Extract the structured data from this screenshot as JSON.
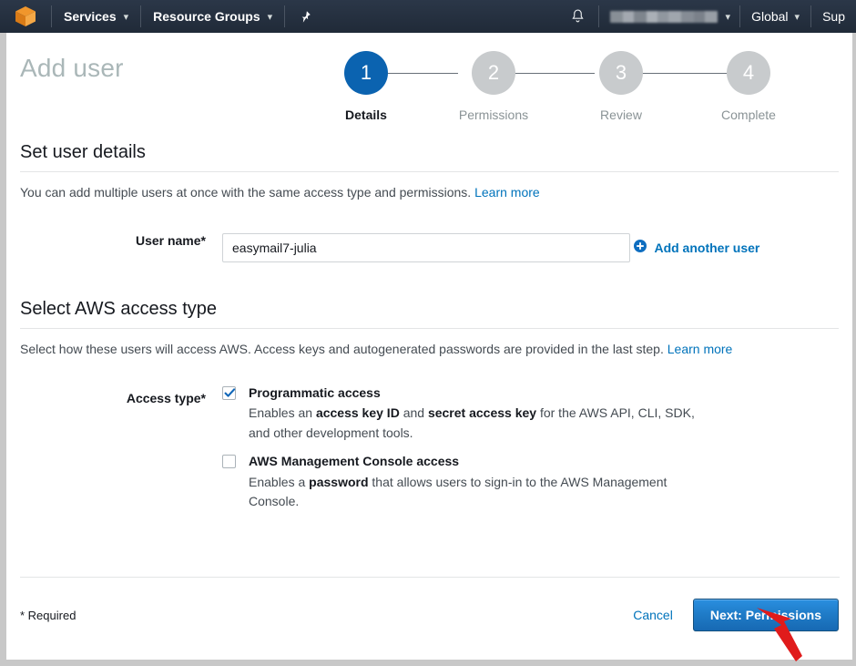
{
  "navbar": {
    "logo_icon": "aws-cube-logo",
    "services_label": "Services",
    "resource_groups_label": "Resource Groups",
    "pin_icon": "pin-icon",
    "bell_icon": "bell-icon",
    "account_label": "",
    "region_label": "Global",
    "support_label": "Sup",
    "caret": "▾",
    "bg_color": "#232f3e",
    "logo_color": "#ec912d"
  },
  "page": {
    "title": "Add user"
  },
  "wizard": {
    "steps": [
      {
        "number": "1",
        "label": "Details",
        "active": true
      },
      {
        "number": "2",
        "label": "Permissions",
        "active": false
      },
      {
        "number": "3",
        "label": "Review",
        "active": false
      },
      {
        "number": "4",
        "label": "Complete",
        "active": false
      }
    ],
    "active_color": "#0b63b0",
    "inactive_color": "#c8cbcd"
  },
  "details_section": {
    "title": "Set user details",
    "description": "You can add multiple users at once with the same access type and permissions.",
    "learn_more": "Learn more",
    "user_name_label": "User name*",
    "user_name_value": "easymail7-julia",
    "user_name_placeholder": "",
    "add_another_label": "Add another user",
    "add_another_icon": "plus-circle-icon"
  },
  "access_section": {
    "title": "Select AWS access type",
    "description": "Select how these users will access AWS. Access keys and autogenerated passwords are provided in the last step.",
    "learn_more": "Learn more",
    "access_type_label": "Access type*",
    "options": [
      {
        "title": "Programmatic access",
        "checked": true,
        "desc_part1": "Enables an ",
        "desc_bold1": "access key ID",
        "desc_part2": " and ",
        "desc_bold2": "secret access key",
        "desc_part3": " for the AWS API, CLI, SDK, and other development tools."
      },
      {
        "title": "AWS Management Console access",
        "checked": false,
        "desc_part1": "Enables a ",
        "desc_bold1": "password",
        "desc_part2": " that allows users to sign-in to the AWS Management Console.",
        "desc_bold2": "",
        "desc_part3": ""
      }
    ]
  },
  "footer": {
    "required_note": "* Required",
    "cancel_label": "Cancel",
    "next_label": "Next: Permissions",
    "primary_color": "#1f7bc7"
  },
  "annotation": {
    "arrow_icon": "red-arrow-pointer",
    "color": "#e01b1b"
  }
}
